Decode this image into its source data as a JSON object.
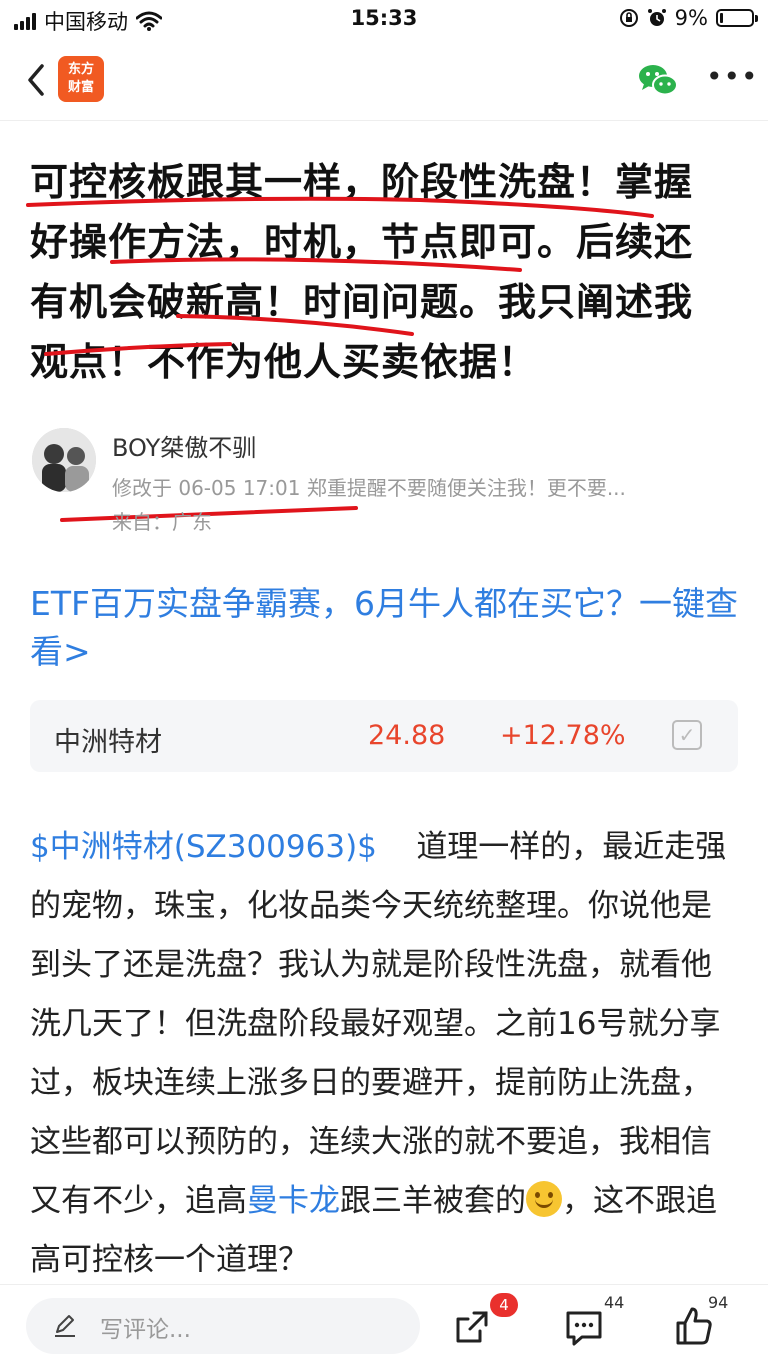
{
  "status": {
    "carrier": "中国移动",
    "time": "15:33",
    "battery": "9%",
    "battery_level": 0.09
  },
  "nav": {
    "logo_line1": "东方",
    "logo_line2": "财富"
  },
  "article": {
    "title": "可控核板跟其一样，阶段性洗盘！掌握好操作方法，时机，节点即可。后续还有机会破新高！时间问题。我只阐述我观点！不作为他人买卖依据！",
    "author_name": "BOY桀傲不驯",
    "meta": "修改于 06-05 17:01 郑重提醒不要随便关注我！更不要...",
    "origin": "来自：广东"
  },
  "promo": {
    "text": "ETF百万实盘争霸赛，6月牛人都在买它？一键查看>"
  },
  "stock": {
    "name": "中洲特材",
    "price": "24.88",
    "change": "+12.78%"
  },
  "body": {
    "stock_link": "$中洲特材(SZ300963)$",
    "part1": "道理一样的，最近走强的宠物，珠宝，化妆品类今天统统整理。你说他是到头了还是洗盘？我认为就是阶段性洗盘，就看他洗几天了！但洗盘阶段最好观望。之前16号就分享过，板块连续上涨多日的要避开，提前防止洗盘，这些都可以预防的，连续大涨的就不要追，我相信又有不少，追高",
    "link2": "曼卡龙",
    "part2": "跟三羊被套的",
    "part3": "，这不跟追高可控核一个道理？"
  },
  "bottom": {
    "comment_placeholder": "写评论...",
    "share_badge": "4",
    "comment_count": "44",
    "like_count": "94"
  },
  "colors": {
    "brand": "#f15a22",
    "link": "#2f7ee0",
    "up": "#e8452c",
    "annotation": "#e0141b"
  }
}
